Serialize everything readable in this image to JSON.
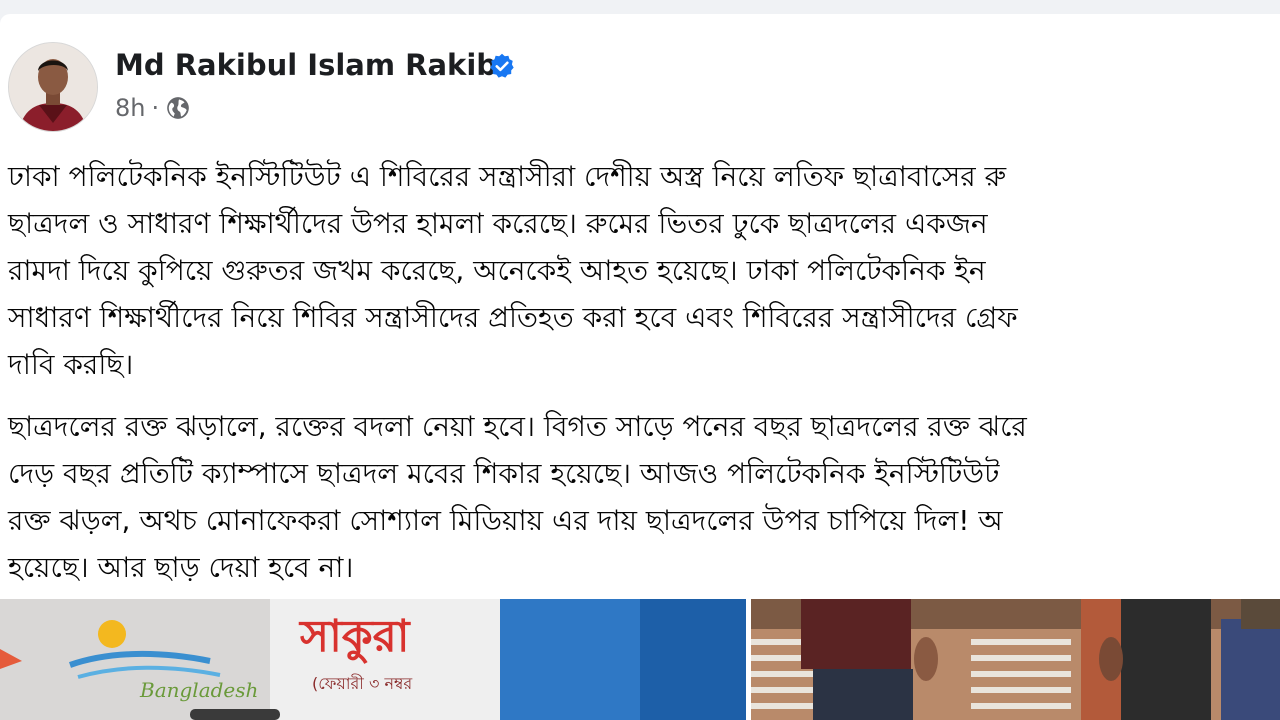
{
  "post": {
    "author": "Md Rakibul Islam Rakib",
    "time": "8h",
    "paragraph1": [
      "ঢাকা পলিটেকনিক ইনস্টিটিউট এ শিবিরের সন্ত্রাসীরা দেশীয় অস্ত্র নিয়ে লতিফ ছাত্রাবাসের রু",
      "ছাত্রদল ও সাধারণ শিক্ষার্থীদের উপর হামলা করেছে। রুমের ভিতর ঢুকে ছাত্রদলের একজন",
      "রামদা দিয়ে কুপিয়ে গুরুতর জখম করেছে, অনেকেই আহত হয়েছে। ঢাকা পলিটেকনিক ইন",
      "সাধারণ শিক্ষার্থীদের নিয়ে শিবির সন্ত্রাসীদের প্রতিহত করা হবে এবং শিবিরের সন্ত্রাসীদের গ্রেফ",
      "দাবি করছি।"
    ],
    "paragraph2": [
      "ছাত্রদলের রক্ত ঝড়ালে, রক্তের বদলা নেয়া হবে। বিগত সাড়ে পনের বছর ছাত্রদলের রক্ত ঝরে",
      "দেড় বছর প্রতিটি ক্যাম্পাসে ছাত্রদল মবের শিকার হয়েছে। আজও পলিটেকনিক ইনস্টিটিউট",
      "রক্ত ঝড়ল, অথচ মোনাফেকরা সোশ্যাল মিডিয়ায় এর দায় ছাত্রদলের উপর চাপিয়ে দিল! অ",
      "হয়েছে। আর ছাড় দেয়া হবে না।"
    ],
    "photo_sign_text": "সাকুরা",
    "photo_sign_small": "(ফেয়ারী ৩ নম্বর"
  }
}
